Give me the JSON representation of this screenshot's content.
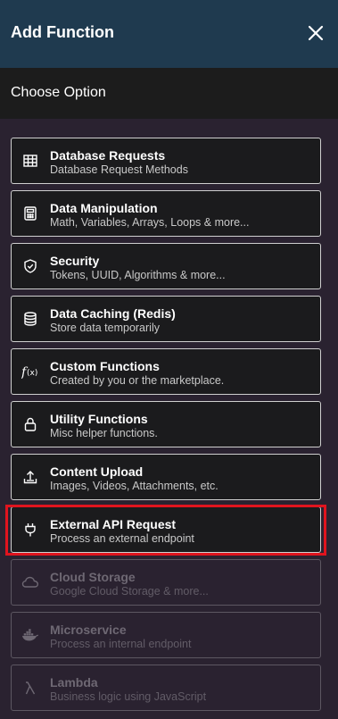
{
  "header": {
    "title": "Add Function"
  },
  "subheader": {
    "title": "Choose Option"
  },
  "items": [
    {
      "title": "Database Requests",
      "desc": "Database Request Methods",
      "icon": "table-icon",
      "disabled": false
    },
    {
      "title": "Data Manipulation",
      "desc": "Math, Variables, Arrays, Loops & more...",
      "icon": "calculator-icon",
      "disabled": false
    },
    {
      "title": "Security",
      "desc": "Tokens, UUID, Algorithms & more...",
      "icon": "shield-check-icon",
      "disabled": false
    },
    {
      "title": "Data Caching (Redis)",
      "desc": "Store data temporarily",
      "icon": "database-icon",
      "disabled": false
    },
    {
      "title": "Custom Functions",
      "desc": "Created by you or the marketplace.",
      "icon": "function-icon",
      "disabled": false
    },
    {
      "title": "Utility Functions",
      "desc": "Misc helper functions.",
      "icon": "lock-icon",
      "disabled": false
    },
    {
      "title": "Content Upload",
      "desc": "Images, Videos, Attachments, etc.",
      "icon": "upload-icon",
      "disabled": false
    },
    {
      "title": "External API Request",
      "desc": "Process an external endpoint",
      "icon": "plug-icon",
      "disabled": false,
      "highlighted": true
    },
    {
      "title": "Cloud Storage",
      "desc": "Google Cloud Storage & more...",
      "icon": "cloud-icon",
      "disabled": true
    },
    {
      "title": "Microservice",
      "desc": "Process an internal endpoint",
      "icon": "docker-icon",
      "disabled": true
    },
    {
      "title": "Lambda",
      "desc": "Business logic using JavaScript",
      "icon": "lambda-icon",
      "disabled": true
    }
  ],
  "colors": {
    "header_bg": "#1f3a4f",
    "page_bg": "#2a2230",
    "highlight": "#e0141e"
  }
}
